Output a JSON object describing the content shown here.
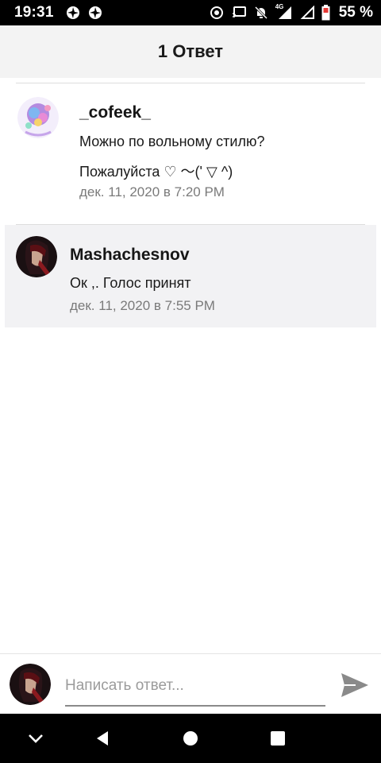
{
  "status_bar": {
    "time": "19:31",
    "battery_text": "55 %",
    "network_label": "4G",
    "icons": [
      "aperture-icon",
      "aperture-icon",
      "data-saver-icon",
      "cast-icon",
      "bell-off-icon",
      "signal-icon",
      "signal-empty-icon",
      "battery-icon"
    ]
  },
  "header": {
    "title": "1 Ответ"
  },
  "comments": [
    {
      "username": "_cofeek_",
      "lines": [
        "Можно по вольному стилю?",
        "Пожалуйста  ♡ 〜(' ▽ ^)"
      ],
      "timestamp": "дек. 11, 2020 в 7:20 PM"
    },
    {
      "username": "Mashachesnov",
      "lines": [
        "Ок ,. Голос принят"
      ],
      "timestamp": "дек. 11, 2020 в 7:55 PM"
    }
  ],
  "reply": {
    "placeholder": "Написать ответ...",
    "value": ""
  },
  "nav": {
    "icons": [
      "chevron-down-icon",
      "back-icon",
      "home-icon",
      "recents-icon"
    ]
  },
  "colors": {
    "header_bg": "#f3f3f3",
    "reply_bg": "#f2f2f4",
    "timestamp": "#7a7a7a",
    "send": "#8a8a8a"
  }
}
